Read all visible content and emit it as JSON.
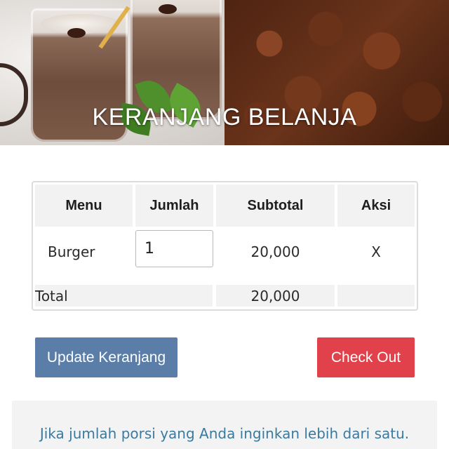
{
  "hero": {
    "title": "KERANJANG BELANJA"
  },
  "cart": {
    "headers": {
      "menu": "Menu",
      "qty": "Jumlah",
      "subtotal": "Subtotal",
      "action": "Aksi"
    },
    "rows": [
      {
        "menu": "Burger",
        "qty": "1",
        "subtotal": "20,000",
        "action": "X"
      }
    ],
    "footer": {
      "label": "Total",
      "total": "20,000"
    }
  },
  "buttons": {
    "update": "Update Keranjang",
    "checkout": "Check Out"
  },
  "info": {
    "text": "Jika jumlah porsi yang Anda inginkan lebih dari satu."
  },
  "colors": {
    "update_button": "#5b7ea9",
    "checkout_button": "#e0414a",
    "info_text": "#3b7a9f"
  }
}
